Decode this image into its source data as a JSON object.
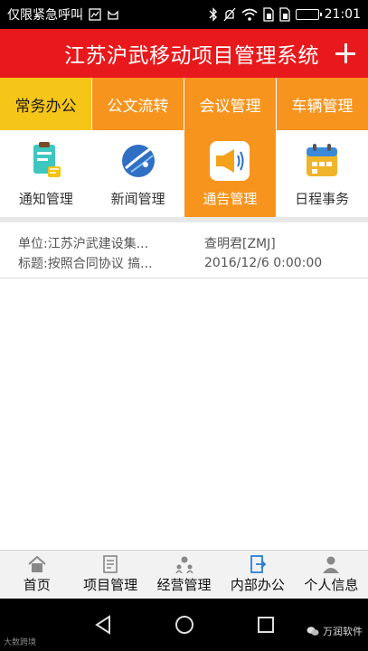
{
  "status_bar": {
    "carrier": "仅限紧急呼叫",
    "time": "21:01",
    "icons": [
      "screenshot-icon",
      "cat-icon",
      "bluetooth-icon",
      "mute-icon",
      "wifi-icon",
      "sim-icon",
      "sim2-icon",
      "battery-icon"
    ]
  },
  "header": {
    "title": "江苏沪武移动项目管理系统",
    "add_icon": "plus-icon"
  },
  "tabs": [
    {
      "label": "常务办公",
      "active": true
    },
    {
      "label": "公文流转",
      "active": false
    },
    {
      "label": "会议管理",
      "active": false
    },
    {
      "label": "车辆管理",
      "active": false
    }
  ],
  "subnav": [
    {
      "label": "通知管理",
      "icon": "notice-clipboard-icon",
      "active": false
    },
    {
      "label": "新闻管理",
      "icon": "news-globe-icon",
      "active": false
    },
    {
      "label": "通告管理",
      "icon": "megaphone-icon",
      "active": true
    },
    {
      "label": "日程事务",
      "icon": "calendar-icon",
      "active": false
    }
  ],
  "record": {
    "unit_label": "单位:",
    "unit_value": "江苏沪武建设集...",
    "person": "查明君[ZMJ]",
    "title_label": "标题:",
    "title_value": "按照合同协议 搞...",
    "datetime": "2016/12/6 0:00:00"
  },
  "bottom_nav": [
    {
      "label": "首页",
      "icon": "home-icon"
    },
    {
      "label": "项目管理",
      "icon": "document-icon"
    },
    {
      "label": "经营管理",
      "icon": "team-icon"
    },
    {
      "label": "内部办公",
      "icon": "office-icon"
    },
    {
      "label": "个人信息",
      "icon": "user-icon"
    }
  ],
  "android_nav": {
    "back": "back-icon",
    "home": "circle-home-icon",
    "recent": "recent-apps-icon"
  },
  "watermarks": {
    "left": "大数跨境",
    "right": "万润软件"
  },
  "colors": {
    "header": "#e8191c",
    "tab_bar": "#f7941d",
    "tab_active": "#f5c518",
    "subnav_active": "#f7941d"
  }
}
